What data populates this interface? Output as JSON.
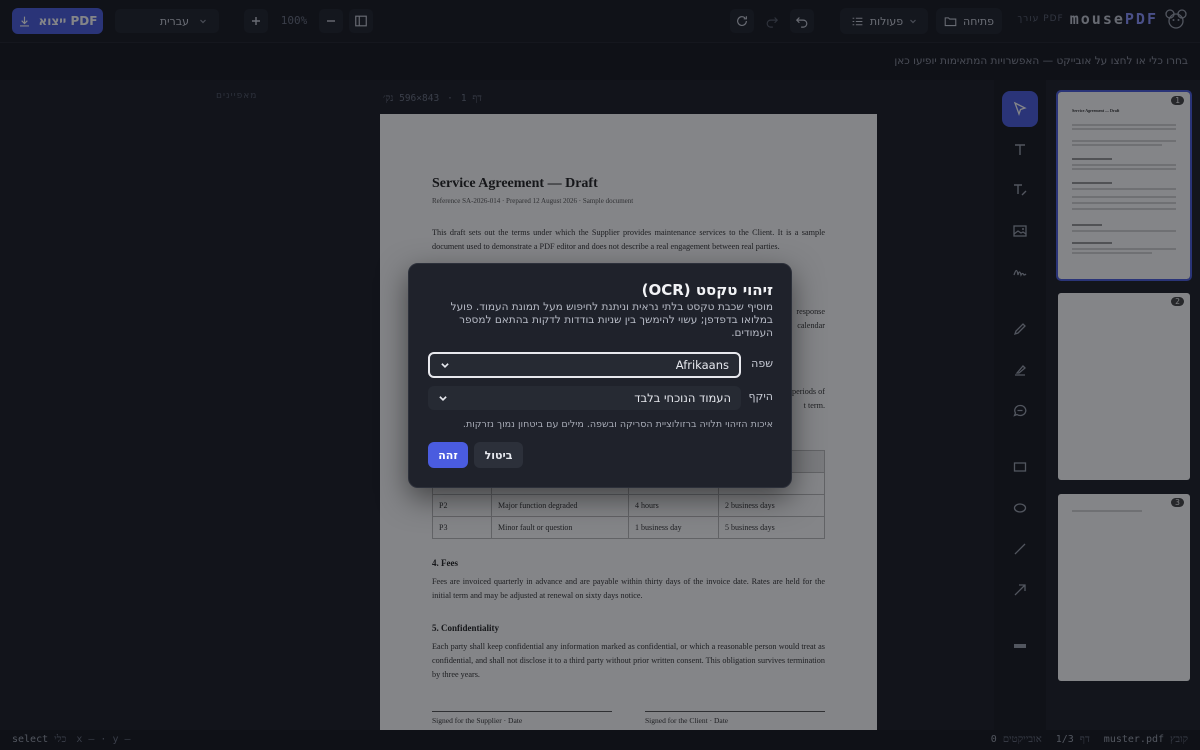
{
  "brand": {
    "name_a": "mouse",
    "name_b": "PDF",
    "tag": "עורך PDF"
  },
  "toolbar": {
    "open_label": "פתיחה",
    "actions_label": "פעולות",
    "zoom": "100%",
    "language": "עברית",
    "export_label": "ייצוא PDF"
  },
  "hint": "בחרו כלי או לחצו על אובייקט — האפשרויות המתאימות יופיעו כאן",
  "props_label": "מאפיינים",
  "page_info": {
    "page": "דף 1",
    "sep": "·",
    "size": "843×596 נק׳"
  },
  "document": {
    "title": "Service Agreement — Draft",
    "reference": "Reference SA-2026-014 · Prepared 12 August 2026 · Sample document",
    "intro": "This draft sets out the terms under which the Supplier provides maintenance services to the Client. It is a sample document used to demonstrate a PDF editor and does not describe a real engagement between real parties.",
    "fragment_response": "response",
    "fragment_calendar": "calendar",
    "fragment_periods": "periods of",
    "fragment_term": "t term.",
    "table_rows": [
      [
        "P2",
        "Major function degraded",
        "4 hours",
        "2 business days"
      ],
      [
        "P3",
        "Minor fault or question",
        "1 business day",
        "5 business days"
      ]
    ],
    "fees_heading": "4. Fees",
    "fees_text": "Fees are invoiced quarterly in advance and are payable within thirty days of the invoice date. Rates are held for the initial term and may be adjusted at renewal on sixty days notice.",
    "conf_heading": "5. Confidentiality",
    "conf_text": "Each party shall keep confidential any information marked as confidential, or which a reasonable person would treat as confidential, and shall not disclose it to a third party without prior written consent. This obligation survives termination by three years.",
    "sig_supplier": "Signed for the Supplier · Date",
    "sig_client": "Signed for the Client · Date"
  },
  "thumbnails": [
    {
      "num": "1",
      "title": "Service Agreement — Draft"
    },
    {
      "num": "2"
    },
    {
      "num": "3"
    }
  ],
  "modal": {
    "title": "זיהוי טקסט (OCR)",
    "description": "מוסיף שכבת טקסט בלתי נראית וניתנת לחיפוש מעל תמונת העמוד. פועל במלואו בדפדפן; עשוי להימשך בין שניות בודדות לדקות בהתאם למספר העמודים.",
    "language_label": "שפה",
    "language_value": "Afrikaans",
    "scope_label": "היקף",
    "scope_value": "העמוד הנוכחי בלבד",
    "note": "איכות הזיהוי תלויה ברזולוציית הסריקה ובשפה. מילים עם ביטחון נמוך נזרקות.",
    "ok_label": "זהה",
    "cancel_label": "ביטול"
  },
  "statusbar": {
    "file_label": "קובץ",
    "file_name": "muster.pdf",
    "page_label": "דף",
    "page_value": "1/3",
    "objects_label": "אובייקטים",
    "objects_value": "0",
    "tool_label": "כלי",
    "tool_value": "select",
    "coords": "x — · y —"
  },
  "colors": {
    "accent": "#4a5cdf",
    "background": "#1a1d25"
  }
}
